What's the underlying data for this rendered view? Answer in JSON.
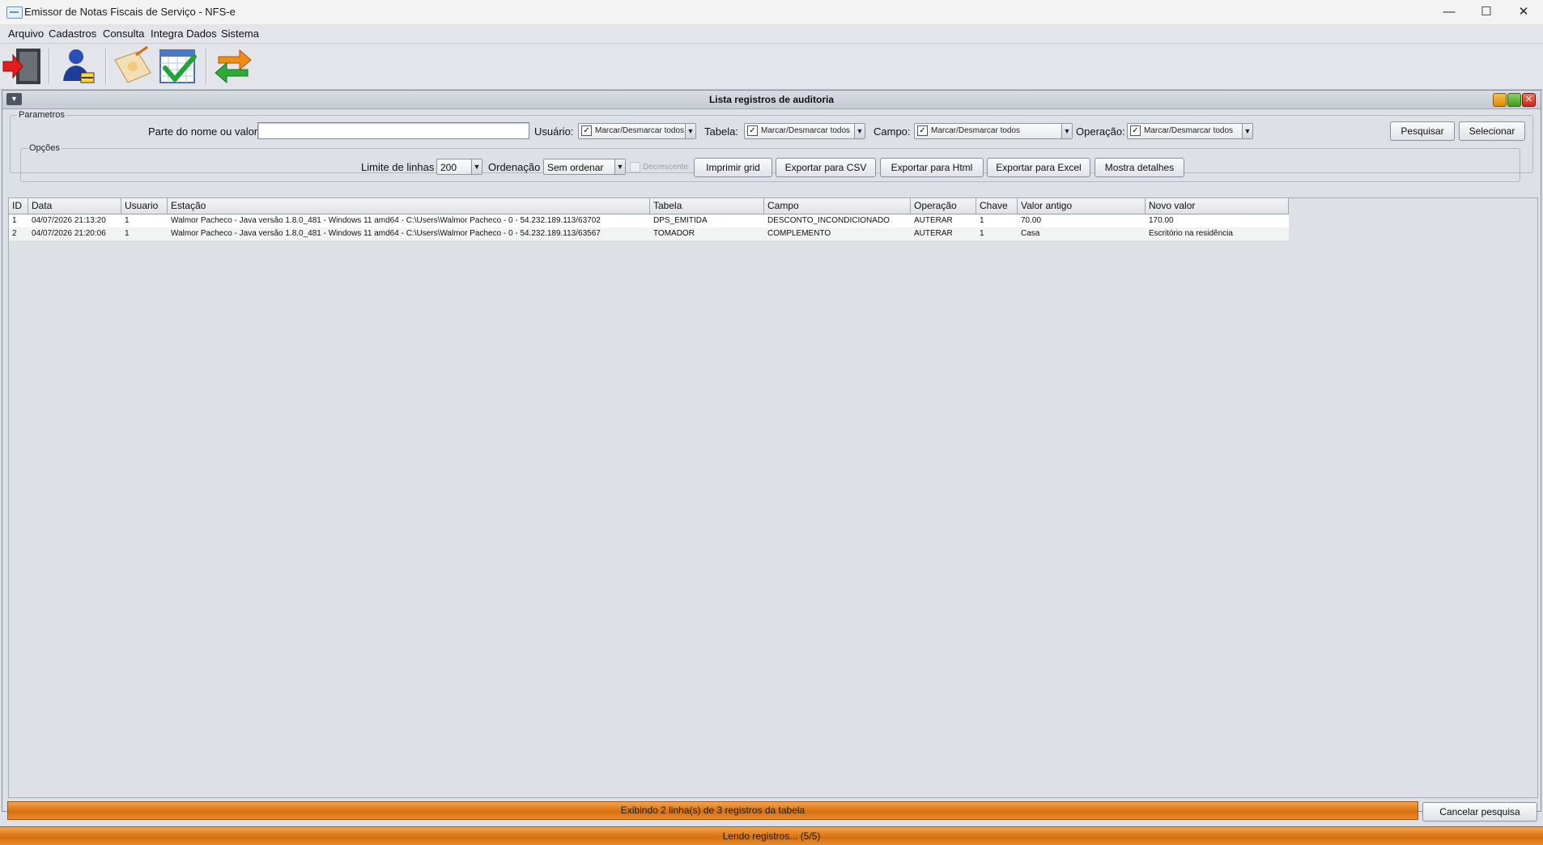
{
  "window": {
    "title": "Emissor de Notas Fiscais de Serviço - NFS-e",
    "minimize": "—",
    "maximize": "☐",
    "close": "✕"
  },
  "menu": [
    "Arquivo",
    "Cadastros",
    "Consulta",
    "Integra Dados",
    "Sistema"
  ],
  "toolbar": {
    "icons": [
      "exit-door-icon",
      "user-icon",
      "notebook-edit-icon",
      "calendar-check-icon",
      "sync-arrows-icon"
    ]
  },
  "frame": {
    "title": "Lista registros de auditoria",
    "system_menu": "▼"
  },
  "params": {
    "legend": "Parametros",
    "search_label": "Parte do nome ou valor:",
    "search_value": "",
    "usuario_label": "Usuário:",
    "tabela_label": "Tabela:",
    "campo_label": "Campo:",
    "operacao_label": "Operação:",
    "mark_all": "Marcar/Desmarcar todos",
    "check": "✓",
    "arrow": "▼",
    "pesquisar": "Pesquisar",
    "selecionar": "Selecionar"
  },
  "options": {
    "legend": "Opções",
    "limit_label": "Limite de linhas",
    "limit_value": "200",
    "order_label": "Ordenação",
    "order_value": "Sem ordenar",
    "decrescente": "Decrescente",
    "imprimir": "Imprimir grid",
    "csv": "Exportar para CSV",
    "html": "Exportar para Html",
    "excel": "Exportar para Excel",
    "detalhes": "Mostra detalhes"
  },
  "table": {
    "columns": [
      "ID",
      "Data",
      "Usuario",
      "Estação",
      "Tabela",
      "Campo",
      "Operação",
      "Chave",
      "Valor antigo",
      "Novo valor"
    ],
    "rows": [
      [
        "1",
        "04/07/2026 21:13:20",
        "1",
        "Walmor Pacheco - Java versão 1.8.0_481 - Windows 11 amd64 - C:\\Users\\Walmor Pacheco - 0 - 54.232.189.113/63702",
        "DPS_EMITIDA",
        "DESCONTO_INCONDICIONADO",
        "AUTERAR",
        "1",
        "70.00",
        "170.00"
      ],
      [
        "2",
        "04/07/2026 21:20:06",
        "1",
        "Walmor Pacheco - Java versão 1.8.0_481 - Windows 11 amd64 - C:\\Users\\Walmor Pacheco - 0 - 54.232.189.113/63567",
        "TOMADOR",
        "COMPLEMENTO",
        "AUTERAR",
        "1",
        "Casa",
        "Escritório na residência"
      ]
    ]
  },
  "status": {
    "text": "Exibindo 2 linha(s) de 3 registros da tabela",
    "cancel": "Cancelar pesquisa",
    "progress": "Lendo registros... (5/5)",
    "progress_fraction": 1.0
  },
  "colors": {
    "accent_orange": "#e07e1c",
    "background": "#dde0e6"
  }
}
